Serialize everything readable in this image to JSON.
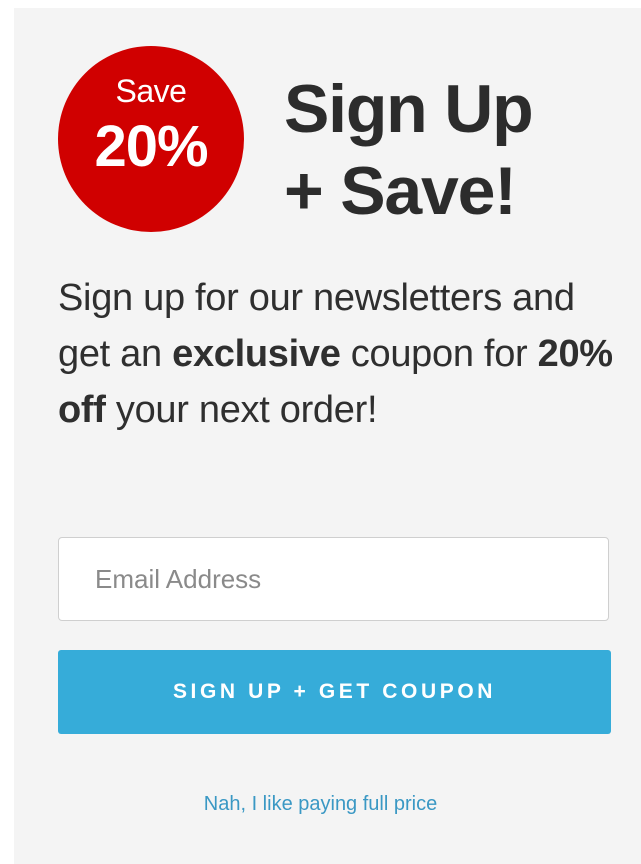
{
  "badge": {
    "small_text": "Save",
    "big_text": "20%"
  },
  "headline": {
    "line1": "Sign Up",
    "line2": "+ Save!"
  },
  "description": {
    "part1": "Sign up for our newsletters and get an ",
    "bold1": "exclusive",
    "part2": " coupon for ",
    "bold2": "20% off",
    "part3": " your next order!"
  },
  "form": {
    "email_placeholder": "Email Address",
    "email_value": "",
    "submit_label": "SIGN UP + GET COUPON"
  },
  "decline_link": "Nah, I like paying full price",
  "colors": {
    "badge": "#d00000",
    "button": "#36acd9",
    "link": "#3a98c4",
    "panel": "#f4f4f4",
    "text": "#2c2c2c"
  }
}
